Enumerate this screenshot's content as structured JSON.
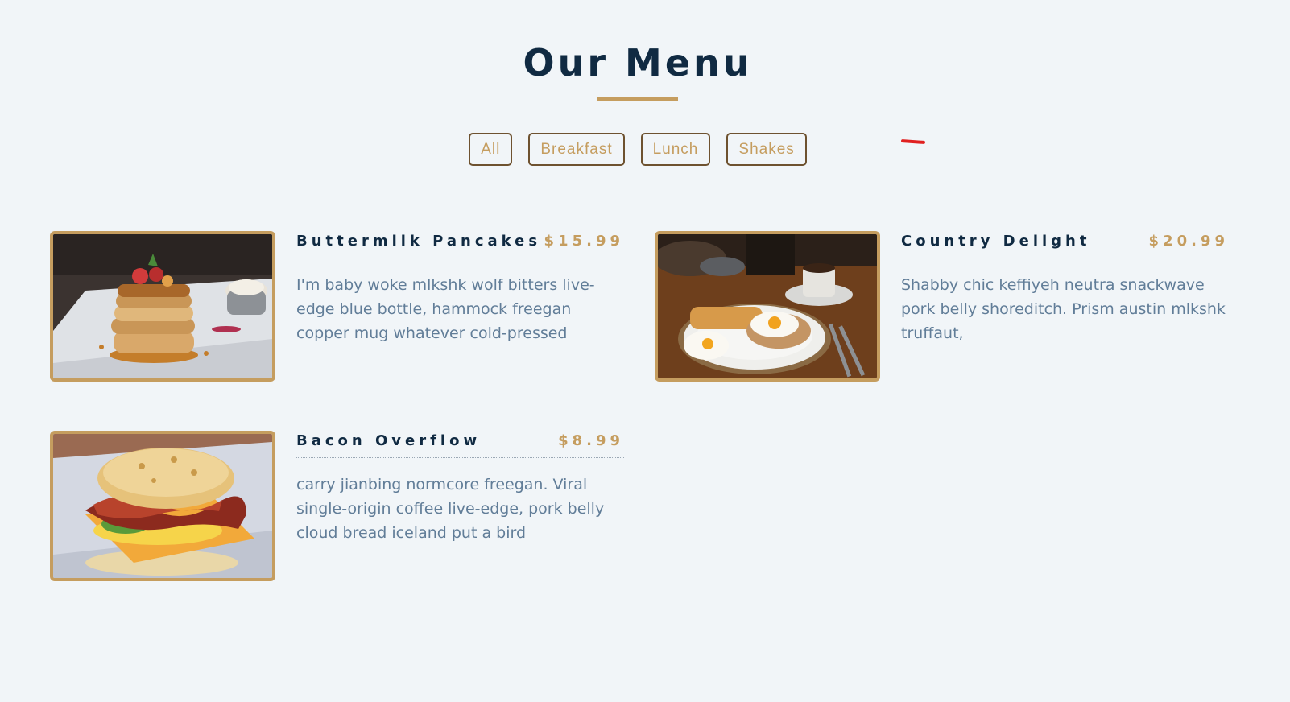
{
  "header": {
    "title": "Our Menu"
  },
  "filters": [
    {
      "label": "All"
    },
    {
      "label": "Breakfast"
    },
    {
      "label": "Lunch"
    },
    {
      "label": "Shakes"
    }
  ],
  "menu_items": [
    {
      "name": "Buttermilk Pancakes",
      "price": "$15.99",
      "description": "I'm baby woke mlkshk wolf bitters live-edge blue bottle, hammock freegan copper mug whatever cold-pressed",
      "image_icon": "pancakes-photo"
    },
    {
      "name": "Country Delight",
      "price": "$20.99",
      "description": "Shabby chic keffiyeh neutra snackwave pork belly shoreditch. Prism austin mlkshk truffaut,",
      "image_icon": "eggs-toast-photo"
    },
    {
      "name": "Bacon Overflow",
      "price": "$8.99",
      "description": "carry jianbing normcore freegan. Viral single-origin coffee live-edge, pork belly cloud bread iceland put a bird",
      "image_icon": "bacon-biscuit-photo"
    }
  ],
  "colors": {
    "accent": "#c59d5f",
    "heading": "#102a42",
    "body_text": "#617d98",
    "background": "#f1f5f8"
  }
}
